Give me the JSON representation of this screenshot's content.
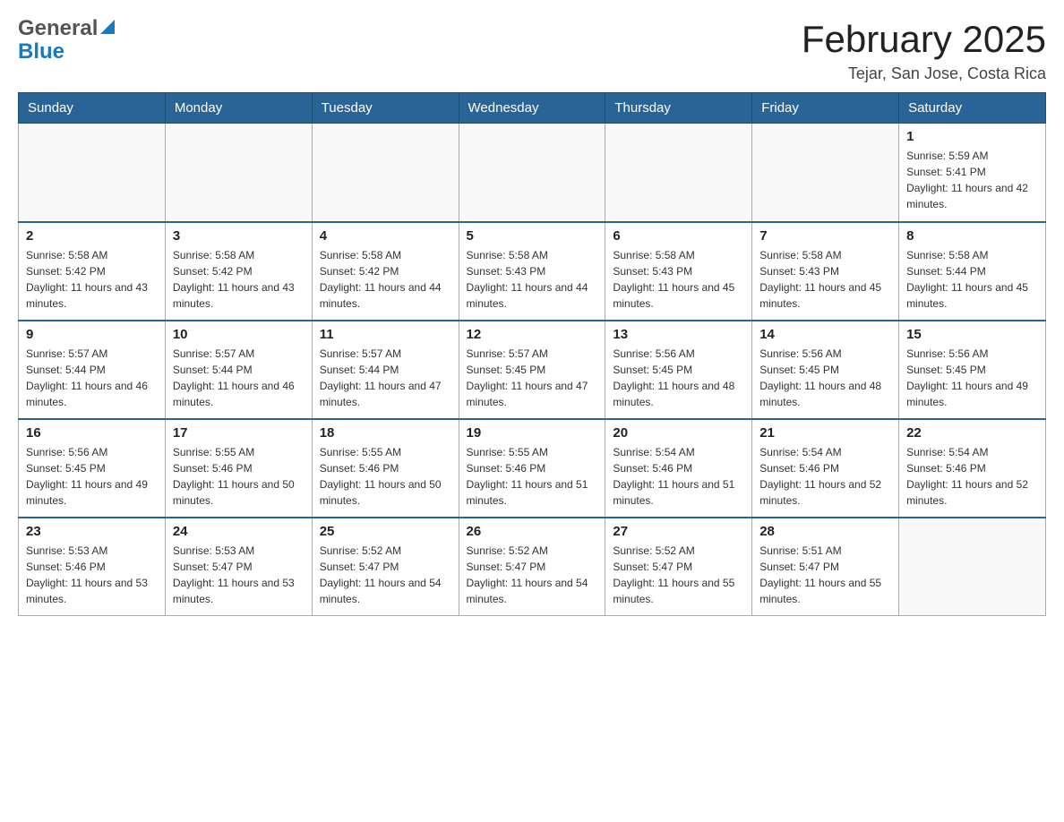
{
  "logo": {
    "general_text": "General",
    "blue_text": "Blue"
  },
  "header": {
    "month_year": "February 2025",
    "location": "Tejar, San Jose, Costa Rica"
  },
  "weekdays": [
    "Sunday",
    "Monday",
    "Tuesday",
    "Wednesday",
    "Thursday",
    "Friday",
    "Saturday"
  ],
  "weeks": [
    [
      {
        "day": "",
        "sunrise": "",
        "sunset": "",
        "daylight": ""
      },
      {
        "day": "",
        "sunrise": "",
        "sunset": "",
        "daylight": ""
      },
      {
        "day": "",
        "sunrise": "",
        "sunset": "",
        "daylight": ""
      },
      {
        "day": "",
        "sunrise": "",
        "sunset": "",
        "daylight": ""
      },
      {
        "day": "",
        "sunrise": "",
        "sunset": "",
        "daylight": ""
      },
      {
        "day": "",
        "sunrise": "",
        "sunset": "",
        "daylight": ""
      },
      {
        "day": "1",
        "sunrise": "Sunrise: 5:59 AM",
        "sunset": "Sunset: 5:41 PM",
        "daylight": "Daylight: 11 hours and 42 minutes."
      }
    ],
    [
      {
        "day": "2",
        "sunrise": "Sunrise: 5:58 AM",
        "sunset": "Sunset: 5:42 PM",
        "daylight": "Daylight: 11 hours and 43 minutes."
      },
      {
        "day": "3",
        "sunrise": "Sunrise: 5:58 AM",
        "sunset": "Sunset: 5:42 PM",
        "daylight": "Daylight: 11 hours and 43 minutes."
      },
      {
        "day": "4",
        "sunrise": "Sunrise: 5:58 AM",
        "sunset": "Sunset: 5:42 PM",
        "daylight": "Daylight: 11 hours and 44 minutes."
      },
      {
        "day": "5",
        "sunrise": "Sunrise: 5:58 AM",
        "sunset": "Sunset: 5:43 PM",
        "daylight": "Daylight: 11 hours and 44 minutes."
      },
      {
        "day": "6",
        "sunrise": "Sunrise: 5:58 AM",
        "sunset": "Sunset: 5:43 PM",
        "daylight": "Daylight: 11 hours and 45 minutes."
      },
      {
        "day": "7",
        "sunrise": "Sunrise: 5:58 AM",
        "sunset": "Sunset: 5:43 PM",
        "daylight": "Daylight: 11 hours and 45 minutes."
      },
      {
        "day": "8",
        "sunrise": "Sunrise: 5:58 AM",
        "sunset": "Sunset: 5:44 PM",
        "daylight": "Daylight: 11 hours and 45 minutes."
      }
    ],
    [
      {
        "day": "9",
        "sunrise": "Sunrise: 5:57 AM",
        "sunset": "Sunset: 5:44 PM",
        "daylight": "Daylight: 11 hours and 46 minutes."
      },
      {
        "day": "10",
        "sunrise": "Sunrise: 5:57 AM",
        "sunset": "Sunset: 5:44 PM",
        "daylight": "Daylight: 11 hours and 46 minutes."
      },
      {
        "day": "11",
        "sunrise": "Sunrise: 5:57 AM",
        "sunset": "Sunset: 5:44 PM",
        "daylight": "Daylight: 11 hours and 47 minutes."
      },
      {
        "day": "12",
        "sunrise": "Sunrise: 5:57 AM",
        "sunset": "Sunset: 5:45 PM",
        "daylight": "Daylight: 11 hours and 47 minutes."
      },
      {
        "day": "13",
        "sunrise": "Sunrise: 5:56 AM",
        "sunset": "Sunset: 5:45 PM",
        "daylight": "Daylight: 11 hours and 48 minutes."
      },
      {
        "day": "14",
        "sunrise": "Sunrise: 5:56 AM",
        "sunset": "Sunset: 5:45 PM",
        "daylight": "Daylight: 11 hours and 48 minutes."
      },
      {
        "day": "15",
        "sunrise": "Sunrise: 5:56 AM",
        "sunset": "Sunset: 5:45 PM",
        "daylight": "Daylight: 11 hours and 49 minutes."
      }
    ],
    [
      {
        "day": "16",
        "sunrise": "Sunrise: 5:56 AM",
        "sunset": "Sunset: 5:45 PM",
        "daylight": "Daylight: 11 hours and 49 minutes."
      },
      {
        "day": "17",
        "sunrise": "Sunrise: 5:55 AM",
        "sunset": "Sunset: 5:46 PM",
        "daylight": "Daylight: 11 hours and 50 minutes."
      },
      {
        "day": "18",
        "sunrise": "Sunrise: 5:55 AM",
        "sunset": "Sunset: 5:46 PM",
        "daylight": "Daylight: 11 hours and 50 minutes."
      },
      {
        "day": "19",
        "sunrise": "Sunrise: 5:55 AM",
        "sunset": "Sunset: 5:46 PM",
        "daylight": "Daylight: 11 hours and 51 minutes."
      },
      {
        "day": "20",
        "sunrise": "Sunrise: 5:54 AM",
        "sunset": "Sunset: 5:46 PM",
        "daylight": "Daylight: 11 hours and 51 minutes."
      },
      {
        "day": "21",
        "sunrise": "Sunrise: 5:54 AM",
        "sunset": "Sunset: 5:46 PM",
        "daylight": "Daylight: 11 hours and 52 minutes."
      },
      {
        "day": "22",
        "sunrise": "Sunrise: 5:54 AM",
        "sunset": "Sunset: 5:46 PM",
        "daylight": "Daylight: 11 hours and 52 minutes."
      }
    ],
    [
      {
        "day": "23",
        "sunrise": "Sunrise: 5:53 AM",
        "sunset": "Sunset: 5:46 PM",
        "daylight": "Daylight: 11 hours and 53 minutes."
      },
      {
        "day": "24",
        "sunrise": "Sunrise: 5:53 AM",
        "sunset": "Sunset: 5:47 PM",
        "daylight": "Daylight: 11 hours and 53 minutes."
      },
      {
        "day": "25",
        "sunrise": "Sunrise: 5:52 AM",
        "sunset": "Sunset: 5:47 PM",
        "daylight": "Daylight: 11 hours and 54 minutes."
      },
      {
        "day": "26",
        "sunrise": "Sunrise: 5:52 AM",
        "sunset": "Sunset: 5:47 PM",
        "daylight": "Daylight: 11 hours and 54 minutes."
      },
      {
        "day": "27",
        "sunrise": "Sunrise: 5:52 AM",
        "sunset": "Sunset: 5:47 PM",
        "daylight": "Daylight: 11 hours and 55 minutes."
      },
      {
        "day": "28",
        "sunrise": "Sunrise: 5:51 AM",
        "sunset": "Sunset: 5:47 PM",
        "daylight": "Daylight: 11 hours and 55 minutes."
      },
      {
        "day": "",
        "sunrise": "",
        "sunset": "",
        "daylight": ""
      }
    ]
  ]
}
